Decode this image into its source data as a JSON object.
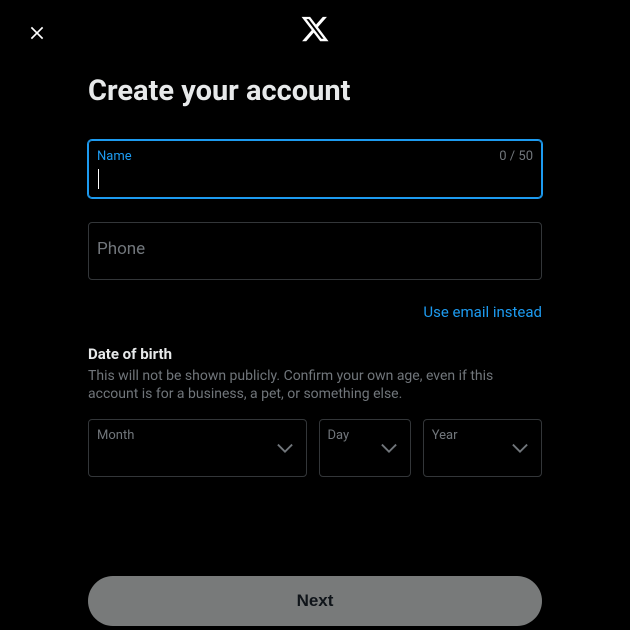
{
  "title": "Create your account",
  "fields": {
    "name": {
      "label": "Name",
      "char_count": "0 / 50",
      "value": ""
    },
    "phone": {
      "label": "Phone",
      "value": ""
    }
  },
  "email_link": "Use email instead",
  "dob": {
    "heading": "Date of birth",
    "description": "This will not be shown publicly. Confirm your own age, even if this account is for a business, a pet, or something else.",
    "month_label": "Month",
    "day_label": "Day",
    "year_label": "Year"
  },
  "next_button": "Next"
}
